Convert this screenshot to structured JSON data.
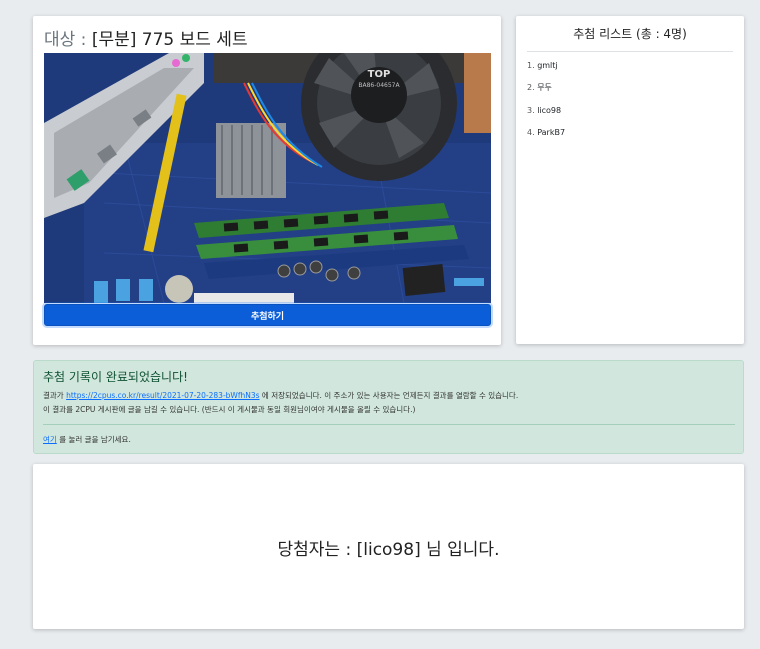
{
  "target": {
    "label": "대상 :",
    "product": "[무분] 775 보드 세트",
    "draw_button": "추첨하기"
  },
  "list": {
    "title": "추첨 리스트 (총 : 4명)",
    "items": [
      {
        "num": "1.",
        "name": "gmltj"
      },
      {
        "num": "2.",
        "name": "무두"
      },
      {
        "num": "3.",
        "name": "lico98"
      },
      {
        "num": "4.",
        "name": "ParkB7"
      }
    ]
  },
  "alert": {
    "heading": "추첨 기록이 완료되었습니다!",
    "line1_prefix": "결과가",
    "result_url": "https://2cpus.co.kr/result/2021-07-20-283-bWfhN3s",
    "line1_suffix": "에 저장되었습니다. 이 주소가 있는 사용자는 언제든지 결과를 열람할 수 있습니다.",
    "line2": "이 결과를 2CPU 게시판에 글을 남길 수 있습니다. (반드시 이 게시물과 동일 회원님이여야 게시물을 올릴 수 있습니다.)",
    "here_link": "여기",
    "line3_suffix": "를 눌러 글을 남기세요."
  },
  "result": {
    "text": "당첨자는 : [lico98] 님 입니다."
  },
  "colors": {
    "primary": "#0b5ed7",
    "alert_bg": "#d1e7dd",
    "alert_text": "#0f5132",
    "page_bg": "#e9ecef"
  }
}
